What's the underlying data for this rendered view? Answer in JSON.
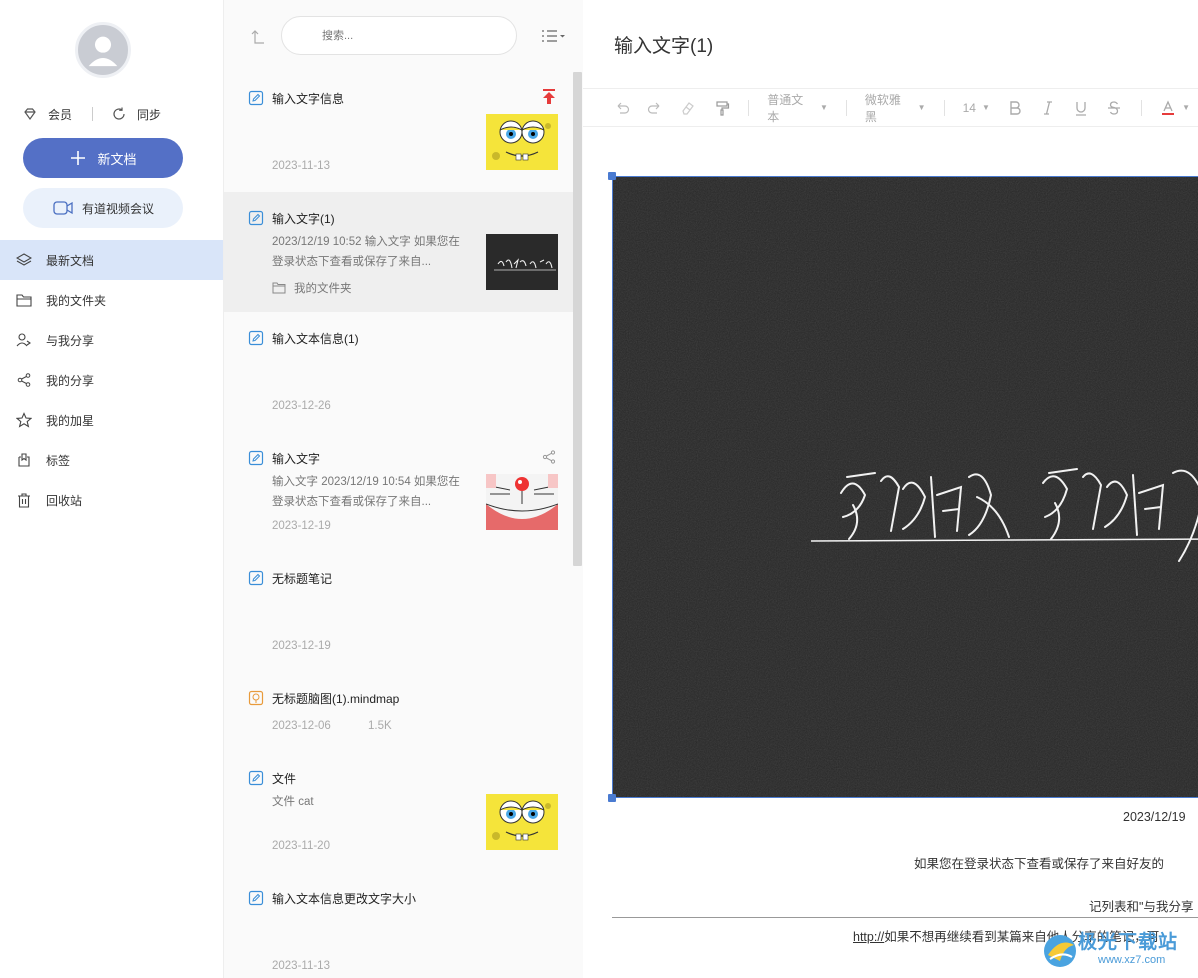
{
  "sidebar": {
    "member_label": "会员",
    "sync_label": "同步",
    "new_doc_label": "新文档",
    "meeting_label": "有道视频会议",
    "nav": [
      {
        "label": "最新文档",
        "icon": "layers-icon",
        "active": true
      },
      {
        "label": "我的文件夹",
        "icon": "folder-icon",
        "active": false
      },
      {
        "label": "与我分享",
        "icon": "users-icon",
        "active": false
      },
      {
        "label": "我的分享",
        "icon": "share-icon",
        "active": false
      },
      {
        "label": "我的加星",
        "icon": "star-icon",
        "active": false
      },
      {
        "label": "标签",
        "icon": "tag-icon",
        "active": false
      },
      {
        "label": "回收站",
        "icon": "trash-icon",
        "active": false
      }
    ]
  },
  "list": {
    "search_placeholder": "搜索...",
    "docs": [
      {
        "title": "输入文字信息",
        "date": "2023-11-13",
        "thumb": "spongebob",
        "pinned": true
      },
      {
        "title": "输入文字(1)",
        "snippet": "2023/12/19 10:52 输入文字 如果您在登录状态下查看或保存了来自...",
        "folder": "我的文件夹",
        "thumb": "calligraphy",
        "selected": true
      },
      {
        "title": "输入文本信息(1)",
        "date": "2023-12-26"
      },
      {
        "title": "输入文字",
        "snippet": "输入文字 2023/12/19 10:54 如果您在登录状态下查看或保存了来自...",
        "date": "2023-12-19",
        "thumb": "doraemon",
        "shared": true
      },
      {
        "title": "无标题笔记",
        "date": "2023-12-19"
      },
      {
        "title": "无标题脑图(1).mindmap",
        "date": "2023-12-06",
        "size": "1.5K",
        "mindmap": true
      },
      {
        "title": "文件",
        "snippet": "文件 cat",
        "date": "2023-11-20",
        "thumb": "spongebob"
      },
      {
        "title": "输入文本信息更改文字大小",
        "date": "2023-11-13"
      }
    ]
  },
  "editor": {
    "title": "输入文字(1)",
    "toolbar": {
      "paragraph_style": "普通文本",
      "font_family": "微软雅黑",
      "font_size": "14"
    },
    "date_line": "2023/12/19",
    "para1": "如果您在登录状态下查看或保存了来自好友的",
    "para2": "记列表和\"与我分享",
    "para3_link": "http://",
    "para3_text": "如果不想再继续看到某篇来自他人分享的笔记，可"
  },
  "watermark": {
    "text": "极光下载站",
    "url": "www.xz7.com"
  },
  "colors": {
    "accent": "#5470c6",
    "nav_active": "#d9e5f9",
    "pin_red": "#e63b3b",
    "selection_blue": "#4a7bd1"
  }
}
